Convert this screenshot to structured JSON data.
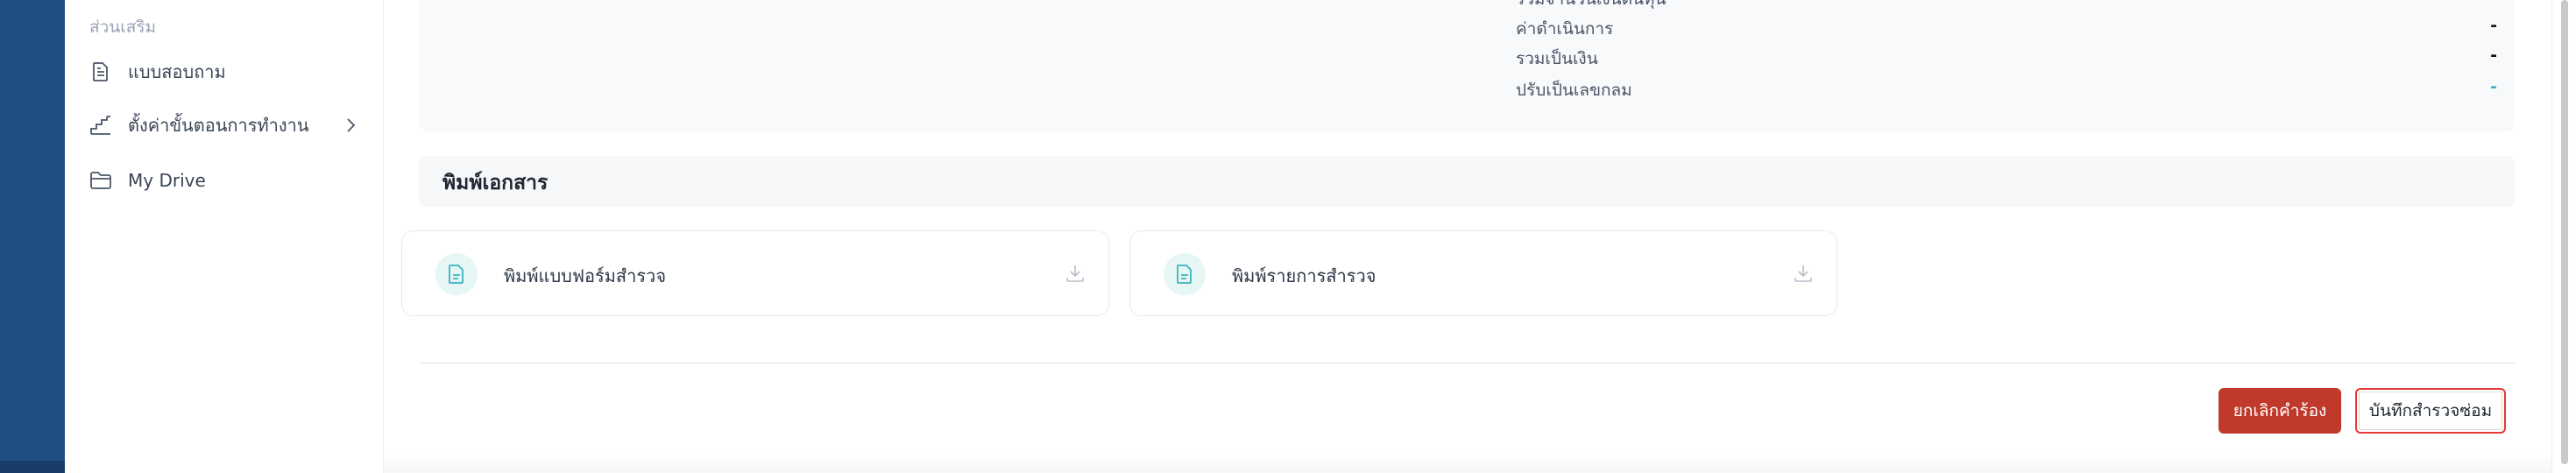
{
  "sidebar": {
    "section_label": "ส่วนเสริม",
    "items": [
      {
        "label": "แบบสอบถาม",
        "icon": "document-icon"
      },
      {
        "label": "ตั้งค่าขั้นตอนการทำงาน",
        "icon": "stairs-icon"
      },
      {
        "label": "My Drive",
        "icon": "folder-icon"
      }
    ]
  },
  "summary": {
    "rows": [
      {
        "label": "รวมจำนวนเงินต้นทุน",
        "value": "-"
      },
      {
        "label": "ค่าดำเนินการ",
        "value": "-"
      },
      {
        "label": "รวมเป็นเงิน",
        "value": "-"
      },
      {
        "label": "ปรับเป็นเลขกลม",
        "value": "-"
      }
    ]
  },
  "print_section": {
    "title": "พิมพ์เอกสาร",
    "cards": [
      {
        "label": "พิมพ์แบบฟอร์มสำรวจ"
      },
      {
        "label": "พิมพ์รายการสำรวจ"
      }
    ]
  },
  "actions": {
    "cancel_label": "ยกเลิกคำร้อง",
    "save_label": "บันทึกสำรวจซ่อม"
  },
  "colors": {
    "rail": "#1f4e83",
    "accent_teal": "#3bb3bd",
    "cancel_red": "#c0392b"
  }
}
